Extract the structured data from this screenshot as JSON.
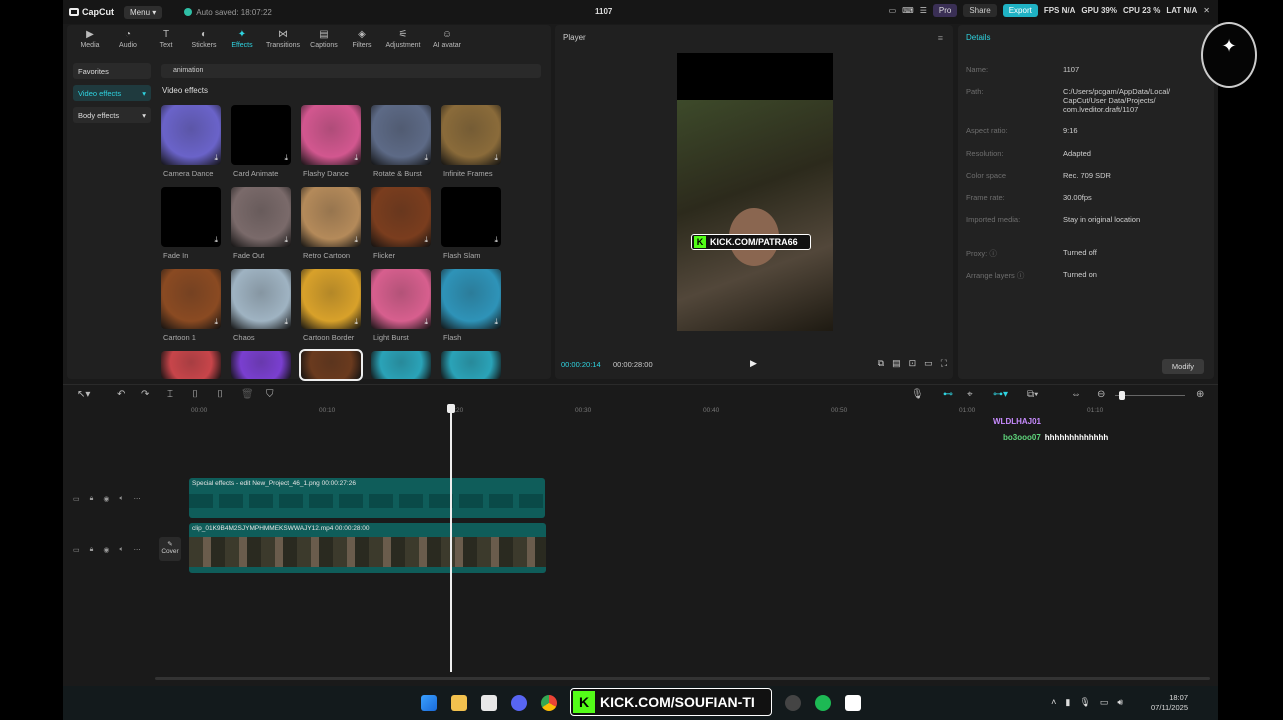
{
  "app": {
    "logo": "CapCut",
    "menu": "Menu",
    "autosave": "Auto saved: 18:07:22",
    "project_title": "1107"
  },
  "topbar_right": {
    "pro": "Pro",
    "share": "Share",
    "export": "Export",
    "hud": {
      "fps": "FPS N/A",
      "gpu": "GPU 39%",
      "cpu": "CPU 23 %",
      "lat": "LAT N/A"
    }
  },
  "toolbar": [
    {
      "label": "Media",
      "icon": "media-icon"
    },
    {
      "label": "Audio",
      "icon": "audio-icon"
    },
    {
      "label": "Text",
      "icon": "text-icon"
    },
    {
      "label": "Stickers",
      "icon": "stickers-icon"
    },
    {
      "label": "Effects",
      "icon": "effects-icon",
      "active": true
    },
    {
      "label": "Transitions",
      "icon": "transitions-icon"
    },
    {
      "label": "Captions",
      "icon": "captions-icon"
    },
    {
      "label": "Filters",
      "icon": "filters-icon"
    },
    {
      "label": "Adjustment",
      "icon": "adjustment-icon"
    },
    {
      "label": "AI avatar",
      "icon": "ai-avatar-icon"
    }
  ],
  "categories": [
    {
      "label": "Favorites",
      "active": false
    },
    {
      "label": "Video effects",
      "active": true
    },
    {
      "label": "Body effects",
      "active": false
    }
  ],
  "search": {
    "value": "animation"
  },
  "section_title": "Video effects",
  "effects": [
    {
      "label": "Camera Dance",
      "color": "#6a63c9"
    },
    {
      "label": "Card Animate",
      "color": "#000000"
    },
    {
      "label": "Flashy Dance",
      "color": "#d2578f"
    },
    {
      "label": "Rotate & Burst",
      "color": "#5d6a86"
    },
    {
      "label": "Infinite Frames",
      "color": "#8a6b3a"
    },
    {
      "label": "Fade In",
      "color": "#000000"
    },
    {
      "label": "Fade Out",
      "color": "#7a6a6a"
    },
    {
      "label": "Retro Cartoon",
      "color": "#b48a5a"
    },
    {
      "label": "Flicker",
      "color": "#7a3d1e"
    },
    {
      "label": "Flash Slam",
      "color": "#000000"
    },
    {
      "label": "Cartoon 1",
      "color": "#8a4a22"
    },
    {
      "label": "Chaos",
      "color": "#9fb3c2"
    },
    {
      "label": "Cartoon Border",
      "color": "#d8a12a"
    },
    {
      "label": "Light Burst",
      "color": "#d75f8e"
    },
    {
      "label": "Flash",
      "color": "#2e93b8"
    },
    {
      "label": "",
      "color": "#c8454a"
    },
    {
      "label": "",
      "color": "#7a3fd0"
    },
    {
      "label": "",
      "color": "#6a3a1e"
    },
    {
      "label": "",
      "color": "#2aa3b8"
    },
    {
      "label": "",
      "color": "#2aa3b8"
    }
  ],
  "player": {
    "title": "Player",
    "current_time": "00:00:20:14",
    "total_time": "00:00:28:00",
    "overlay": "KICK.COM/PATRA66"
  },
  "details": {
    "title": "Details",
    "rows": [
      {
        "k": "Name:",
        "v": "1107"
      },
      {
        "k": "Path:",
        "v": "C:/Users/pcgam/AppData/Local/ CapCut/User Data/Projects/ com.lveditor.draft/1107"
      },
      {
        "k": "Aspect ratio:",
        "v": "9:16"
      },
      {
        "k": "Resolution:",
        "v": "Adapted"
      },
      {
        "k": "Color space",
        "v": "Rec. 709 SDR"
      },
      {
        "k": "Frame rate:",
        "v": "30.00fps"
      },
      {
        "k": "Imported media:",
        "v": "Stay in original location"
      },
      {
        "k": "Proxy: ⓘ",
        "v": "Turned off"
      },
      {
        "k": "Arrange layers ⓘ",
        "v": "Turned on"
      }
    ],
    "modify": "Modify"
  },
  "ruler": [
    "00:00",
    "00:10",
    "00:20",
    "00:30",
    "00:40",
    "00:50",
    "01:00",
    "01:10"
  ],
  "tracks": {
    "effect_clip": "Special effects - edit   New_Project_46_1.png   00:00:27:26",
    "video_clip": "clip_01K9B4M2SJYMPHMMEKSWWAJY12.mp4   00:00:28:00",
    "cover": "Cover"
  },
  "chat": [
    {
      "user": "WLDLHAJ01",
      "msg": "",
      "color": "#c88cff"
    },
    {
      "user": "bo3ooo07",
      "msg": "hhhhhhhhhhhhh",
      "color": "#5fd67c"
    }
  ],
  "taskbar": {
    "kick_url": "KICK.COM/SOUFIAN-TI",
    "time": "18:07",
    "date": "07/11/2025"
  },
  "overlay_logo": "N/A"
}
